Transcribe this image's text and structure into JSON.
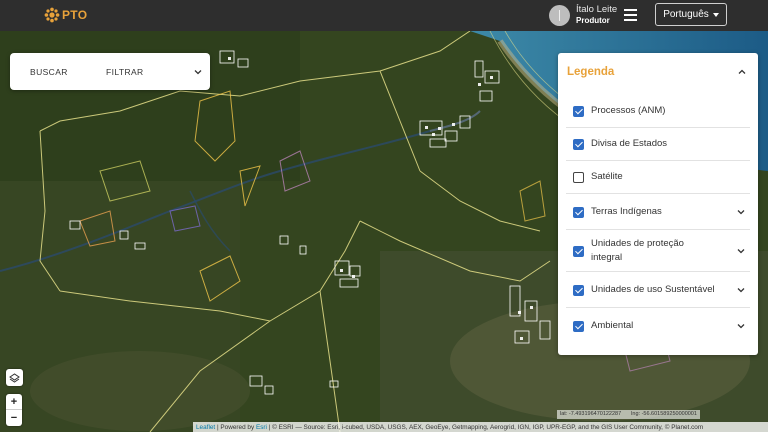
{
  "header": {
    "logo_text": "PTO",
    "user_name": "Ítalo Leite",
    "user_role": "Produtor",
    "language": "Português"
  },
  "search": {
    "search_label": "BUSCAR",
    "filter_label": "FILTRAR"
  },
  "legend": {
    "title": "Legenda",
    "items": [
      {
        "label": "Processos (ANM)",
        "checked": true,
        "expandable": false
      },
      {
        "label": "Divisa de Estados",
        "checked": true,
        "expandable": false
      },
      {
        "label": "Satélite",
        "checked": false,
        "expandable": false
      },
      {
        "label": "Terras Indígenas",
        "checked": true,
        "expandable": true
      },
      {
        "label": "Unidades de proteção integral",
        "checked": true,
        "expandable": true
      },
      {
        "label": "Unidades de uso Sustentável",
        "checked": true,
        "expandable": true
      },
      {
        "label": "Ambiental",
        "checked": true,
        "expandable": true
      }
    ]
  },
  "map": {
    "zoom_in": "+",
    "zoom_out": "−",
    "coord_lat": "lat: -7.4931964701222​87",
    "coord_lng": "lng: -56.6015892500000​01",
    "attribution_leaflet": "Leaflet",
    "attribution_mid": " | Powered by ",
    "attribution_esri": "Esri",
    "attribution_rest": " | © ESRI — Source: Esri, i-cubed, USDA, USGS, AEX, GeoEye, Getmapping, Aerogrid, IGN, IGP, UPR-EGP, and the GIS User Community, © Planet.com"
  },
  "colors": {
    "brand": "#e8a23a",
    "checkbox": "#2e6cc4",
    "topbar": "#2e2e2e"
  },
  "icons": {
    "logo": "sun-logo-icon",
    "menu": "hamburger-icon",
    "lang": "caret-down-icon",
    "filter": "chevron-down-icon",
    "legend": "chevron-up-icon",
    "layers": "layers-icon"
  }
}
